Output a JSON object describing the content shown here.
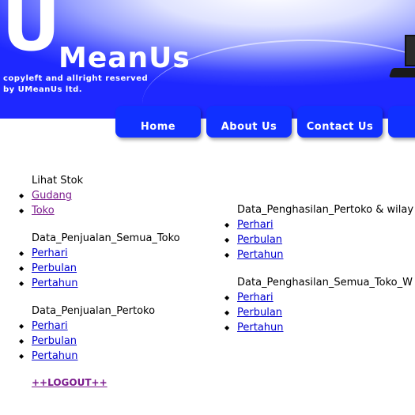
{
  "banner": {
    "logo_letter": "U",
    "logo_text": "MeanUs",
    "copyright_line1": "copyleft and allright reserved",
    "copyright_line2": "by UMeanUs ltd."
  },
  "nav": {
    "items": [
      {
        "label": "Home"
      },
      {
        "label": "About Us"
      },
      {
        "label": "Contact Us"
      },
      {
        "label": ""
      }
    ]
  },
  "left_column": {
    "sections": [
      {
        "heading": "Lihat Stok",
        "links": [
          "Gudang",
          "Toko"
        ]
      },
      {
        "heading": "Data_Penjualan_Semua_Toko",
        "links": [
          "Perhari",
          "Perbulan",
          "Pertahun"
        ]
      },
      {
        "heading": "Data_Penjualan_Pertoko",
        "links": [
          "Perhari",
          "Perbulan",
          "Pertahun"
        ]
      }
    ]
  },
  "right_column": {
    "sections": [
      {
        "heading": "Data_Penghasilan_Pertoko & wilay",
        "links": [
          "Perhari",
          "Perbulan",
          "Pertahun"
        ]
      },
      {
        "heading": "Data_Penghasilan_Semua_Toko_W",
        "links": [
          "Perhari",
          "Perbulan",
          "Pertahun"
        ]
      }
    ]
  },
  "logout_label": "++LOGOUT++",
  "colors": {
    "banner_blue": "#1e28ff",
    "link": "#0000d0",
    "visited_link": "#7a1a8c"
  }
}
